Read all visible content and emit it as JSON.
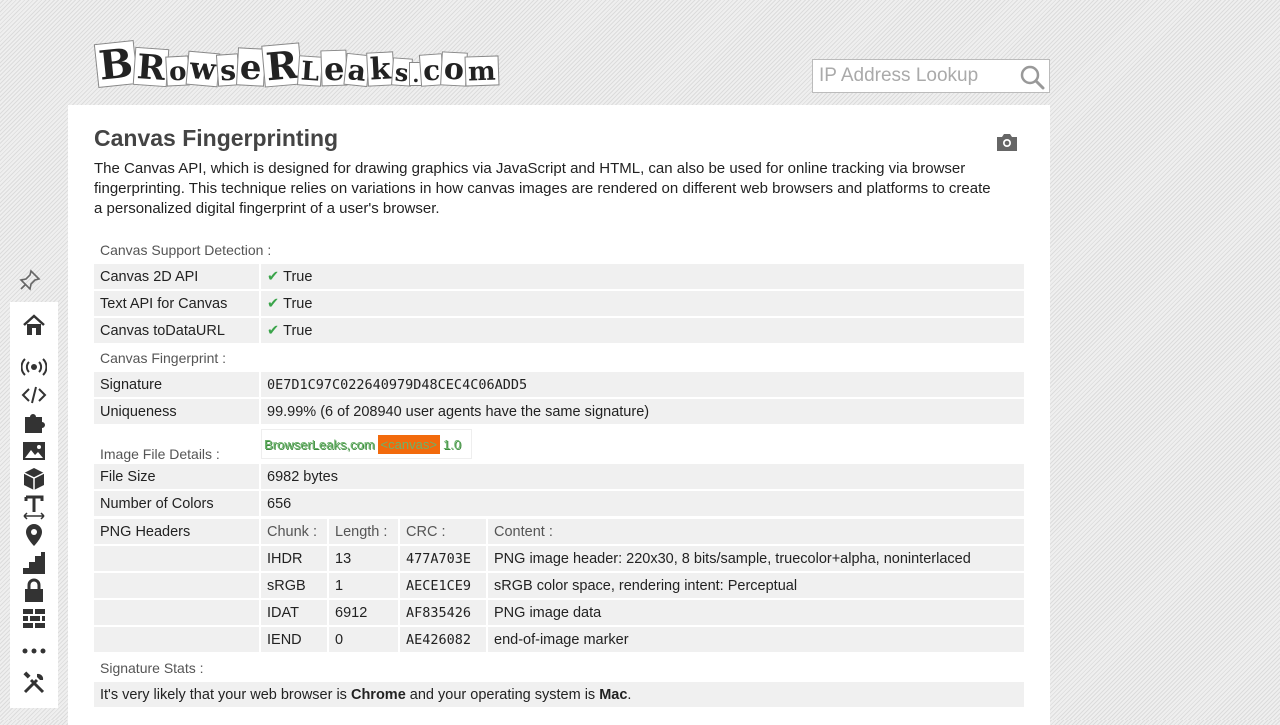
{
  "header": {
    "logo_text": "BRowseRLeaks.com",
    "search_placeholder": "IP Address Lookup"
  },
  "sidebar": {
    "icons": [
      "home-icon",
      "broadcast-icon",
      "code-icon",
      "puzzle-icon",
      "image-icon",
      "cube-icon",
      "text-icon",
      "location-icon",
      "stairs-icon",
      "lock-icon",
      "wall-icon",
      "more-icon",
      "tools-icon"
    ]
  },
  "page": {
    "title": "Canvas Fingerprinting",
    "intro": "The Canvas API, which is designed for drawing graphics via JavaScript and HTML, can also be used for online tracking via browser fingerprinting. This technique relies on variations in how canvas images are rendered on different web browsers and platforms to create a personalized digital fingerprint of a user's browser."
  },
  "support": {
    "heading": "Canvas Support Detection :",
    "rows": [
      {
        "label": "Canvas 2D API",
        "value": "True"
      },
      {
        "label": "Text API for Canvas",
        "value": "True"
      },
      {
        "label": "Canvas toDataURL",
        "value": "True"
      }
    ]
  },
  "fingerprint": {
    "heading": "Canvas Fingerprint :",
    "signature_label": "Signature",
    "signature_value": "0E7D1C97C022640979D48CEC4C06ADD5",
    "uniqueness_label": "Uniqueness",
    "uniqueness_value": "99.99% (6 of 208940 user agents have the same signature)"
  },
  "image": {
    "heading": "Image File Details :",
    "canvas_text_1": "BrowserLeaks,com",
    "canvas_text_2": "<canvas>",
    "canvas_text_3": "1.0",
    "file_size_label": "File Size",
    "file_size_value": "6982 bytes",
    "colors_label": "Number of Colors",
    "colors_value": "656",
    "png_label": "PNG Headers",
    "png_columns": [
      "Chunk :",
      "Length :",
      "CRC :",
      "Content :"
    ],
    "png_rows": [
      [
        "IHDR",
        "13",
        "477A703E",
        "PNG image header: 220x30, 8 bits/sample, truecolor+alpha, noninterlaced"
      ],
      [
        "sRGB",
        "1",
        "AECE1CE9",
        "sRGB color space, rendering intent: Perceptual"
      ],
      [
        "IDAT",
        "6912",
        "AF835426",
        "PNG image data"
      ],
      [
        "IEND",
        "0",
        "AE426082",
        "end-of-image marker"
      ]
    ]
  },
  "stats": {
    "heading": "Signature Stats :",
    "text_1": "It's very likely that your web browser is ",
    "browser": "Chrome",
    "text_2": " and your operating system is ",
    "os": "Mac",
    "text_3": "."
  },
  "colors": {
    "check": "#3aa44a",
    "row_bg": "#f0f0f0",
    "canvas_orange": "#f26a0c"
  }
}
